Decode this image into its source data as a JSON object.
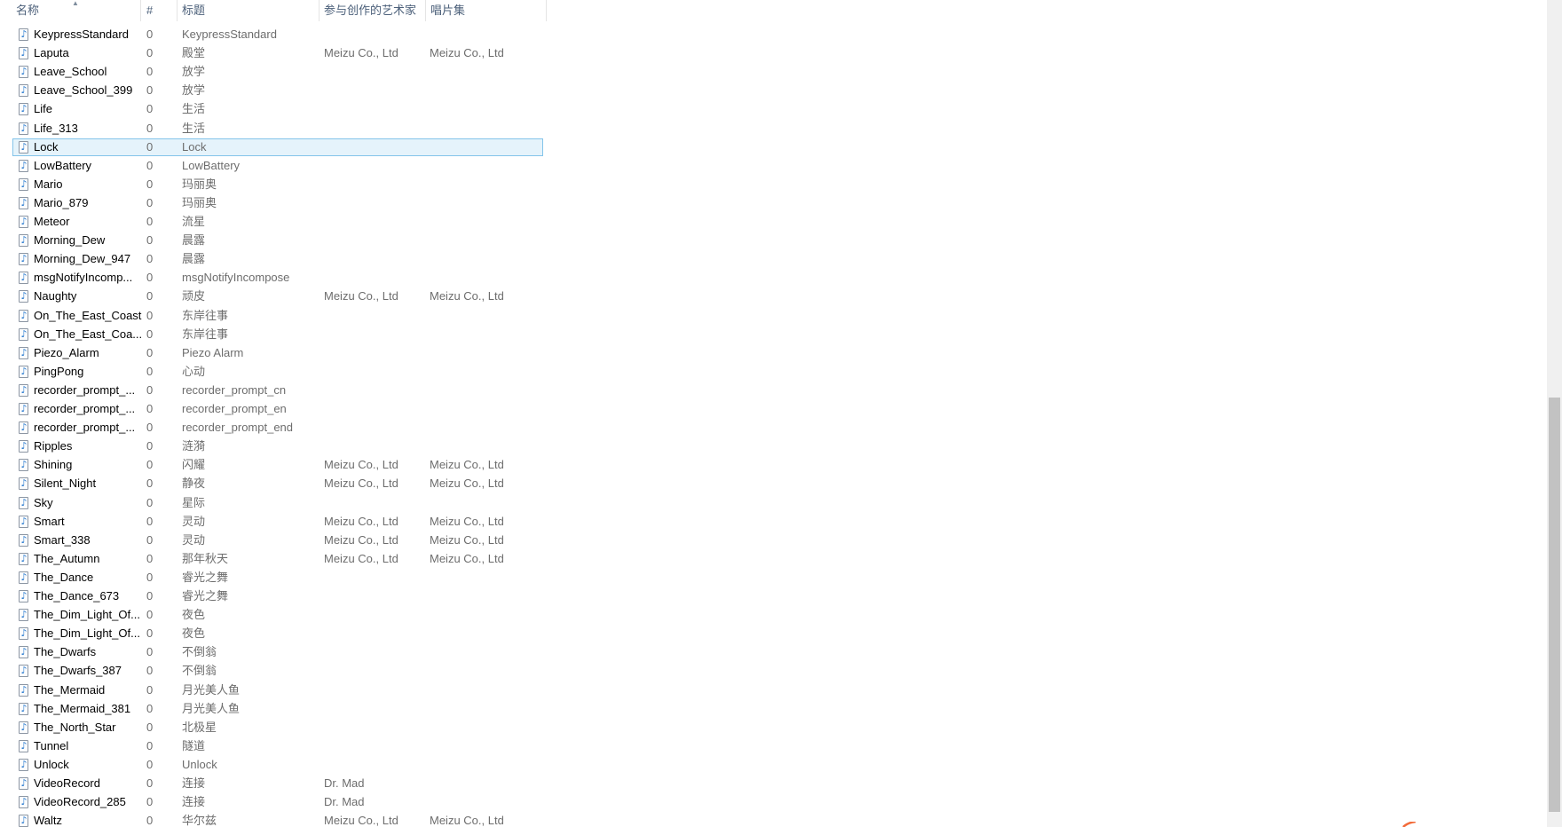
{
  "columns": {
    "name": "名称",
    "number": "#",
    "title": "标题",
    "artist": "参与创作的艺术家",
    "album": "唱片集"
  },
  "icons": {
    "file": "audio-file-icon",
    "sort": "sort-ascending-icon"
  },
  "colors": {
    "selection_bg": "#e5f3fb",
    "selection_border": "#84c4ea",
    "header_text": "#4c607a"
  },
  "selected_row_index": 6,
  "rows": [
    {
      "name": "KeypressStandard",
      "number": "0",
      "title": "KeypressStandard",
      "artist": "",
      "album": ""
    },
    {
      "name": "Laputa",
      "number": "0",
      "title": "殿堂",
      "artist": "Meizu Co., Ltd",
      "album": "Meizu Co., Ltd"
    },
    {
      "name": "Leave_School",
      "number": "0",
      "title": "放学",
      "artist": "",
      "album": ""
    },
    {
      "name": "Leave_School_399",
      "number": "0",
      "title": "放学",
      "artist": "",
      "album": ""
    },
    {
      "name": "Life",
      "number": "0",
      "title": "生活",
      "artist": "",
      "album": ""
    },
    {
      "name": "Life_313",
      "number": "0",
      "title": "生活",
      "artist": "",
      "album": ""
    },
    {
      "name": "Lock",
      "number": "0",
      "title": "Lock",
      "artist": "",
      "album": ""
    },
    {
      "name": "LowBattery",
      "number": "0",
      "title": "LowBattery",
      "artist": "",
      "album": ""
    },
    {
      "name": "Mario",
      "number": "0",
      "title": "玛丽奥",
      "artist": "",
      "album": ""
    },
    {
      "name": "Mario_879",
      "number": "0",
      "title": "玛丽奥",
      "artist": "",
      "album": ""
    },
    {
      "name": "Meteor",
      "number": "0",
      "title": "流星",
      "artist": "",
      "album": ""
    },
    {
      "name": "Morning_Dew",
      "number": "0",
      "title": "晨露",
      "artist": "",
      "album": ""
    },
    {
      "name": "Morning_Dew_947",
      "number": "0",
      "title": "晨露",
      "artist": "",
      "album": ""
    },
    {
      "name": "msgNotifyIncomp...",
      "number": "0",
      "title": "msgNotifyIncompose",
      "artist": "",
      "album": ""
    },
    {
      "name": "Naughty",
      "number": "0",
      "title": "顽皮",
      "artist": "Meizu Co., Ltd",
      "album": "Meizu Co., Ltd"
    },
    {
      "name": "On_The_East_Coast",
      "number": "0",
      "title": "东岸往事",
      "artist": "",
      "album": ""
    },
    {
      "name": "On_The_East_Coa...",
      "number": "0",
      "title": "东岸往事",
      "artist": "",
      "album": ""
    },
    {
      "name": "Piezo_Alarm",
      "number": "0",
      "title": "Piezo Alarm",
      "artist": "",
      "album": ""
    },
    {
      "name": "PingPong",
      "number": "0",
      "title": "心动",
      "artist": "",
      "album": ""
    },
    {
      "name": "recorder_prompt_...",
      "number": "0",
      "title": "recorder_prompt_cn",
      "artist": "",
      "album": ""
    },
    {
      "name": "recorder_prompt_...",
      "number": "0",
      "title": "recorder_prompt_en",
      "artist": "",
      "album": ""
    },
    {
      "name": "recorder_prompt_...",
      "number": "0",
      "title": "recorder_prompt_end",
      "artist": "",
      "album": ""
    },
    {
      "name": "Ripples",
      "number": "0",
      "title": "涟漪",
      "artist": "",
      "album": ""
    },
    {
      "name": "Shining",
      "number": "0",
      "title": "闪耀",
      "artist": "Meizu Co., Ltd",
      "album": "Meizu Co., Ltd"
    },
    {
      "name": "Silent_Night",
      "number": "0",
      "title": "静夜",
      "artist": "Meizu Co., Ltd",
      "album": "Meizu Co., Ltd"
    },
    {
      "name": "Sky",
      "number": "0",
      "title": "星际",
      "artist": "",
      "album": ""
    },
    {
      "name": "Smart",
      "number": "0",
      "title": "灵动",
      "artist": "Meizu Co., Ltd",
      "album": "Meizu Co., Ltd"
    },
    {
      "name": "Smart_338",
      "number": "0",
      "title": "灵动",
      "artist": "Meizu Co., Ltd",
      "album": "Meizu Co., Ltd"
    },
    {
      "name": "The_Autumn",
      "number": "0",
      "title": "那年秋天",
      "artist": "Meizu Co., Ltd",
      "album": "Meizu Co., Ltd"
    },
    {
      "name": "The_Dance",
      "number": "0",
      "title": "睿光之舞",
      "artist": "",
      "album": ""
    },
    {
      "name": "The_Dance_673",
      "number": "0",
      "title": "睿光之舞",
      "artist": "",
      "album": ""
    },
    {
      "name": "The_Dim_Light_Of...",
      "number": "0",
      "title": "夜色",
      "artist": "",
      "album": ""
    },
    {
      "name": "The_Dim_Light_Of...",
      "number": "0",
      "title": "夜色",
      "artist": "",
      "album": ""
    },
    {
      "name": "The_Dwarfs",
      "number": "0",
      "title": "不倒翁",
      "artist": "",
      "album": ""
    },
    {
      "name": "The_Dwarfs_387",
      "number": "0",
      "title": "不倒翁",
      "artist": "",
      "album": ""
    },
    {
      "name": "The_Mermaid",
      "number": "0",
      "title": "月光美人鱼",
      "artist": "",
      "album": ""
    },
    {
      "name": "The_Mermaid_381",
      "number": "0",
      "title": "月光美人鱼",
      "artist": "",
      "album": ""
    },
    {
      "name": "The_North_Star",
      "number": "0",
      "title": "北极星",
      "artist": "",
      "album": ""
    },
    {
      "name": "Tunnel",
      "number": "0",
      "title": "隧道",
      "artist": "",
      "album": ""
    },
    {
      "name": "Unlock",
      "number": "0",
      "title": "Unlock",
      "artist": "",
      "album": ""
    },
    {
      "name": "VideoRecord",
      "number": "0",
      "title": "连接",
      "artist": "Dr. Mad",
      "album": ""
    },
    {
      "name": "VideoRecord_285",
      "number": "0",
      "title": "连接",
      "artist": "Dr. Mad",
      "album": ""
    },
    {
      "name": "Waltz",
      "number": "0",
      "title": "华尔兹",
      "artist": "Meizu Co., Ltd",
      "album": "Meizu Co., Ltd"
    }
  ]
}
